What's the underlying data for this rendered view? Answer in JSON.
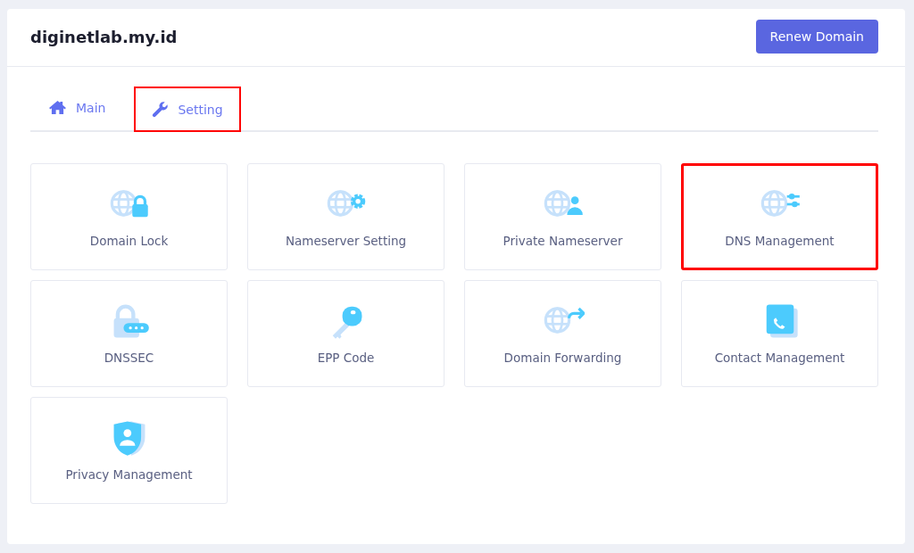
{
  "header": {
    "title": "diginetlab.my.id",
    "button": "Renew Domain"
  },
  "tabs": [
    {
      "label": "Main",
      "kind": "home",
      "highlighted": false
    },
    {
      "label": "Setting",
      "kind": "wrench",
      "highlighted": true
    }
  ],
  "tiles": [
    {
      "label": "Domain Lock",
      "kind": "globelock",
      "highlighted": false
    },
    {
      "label": "Nameserver Setting",
      "kind": "globegear",
      "highlighted": false
    },
    {
      "label": "Private Nameserver",
      "kind": "globeperson",
      "highlighted": false
    },
    {
      "label": "DNS Management",
      "kind": "globesliders",
      "highlighted": true
    },
    {
      "label": "DNSSEC",
      "kind": "padlock",
      "highlighted": false
    },
    {
      "label": "EPP Code",
      "kind": "key",
      "highlighted": false
    },
    {
      "label": "Domain Forwarding",
      "kind": "globearrow",
      "highlighted": false
    },
    {
      "label": "Contact Management",
      "kind": "phone",
      "highlighted": false
    },
    {
      "label": "Privacy Management",
      "kind": "shield",
      "highlighted": false
    }
  ]
}
